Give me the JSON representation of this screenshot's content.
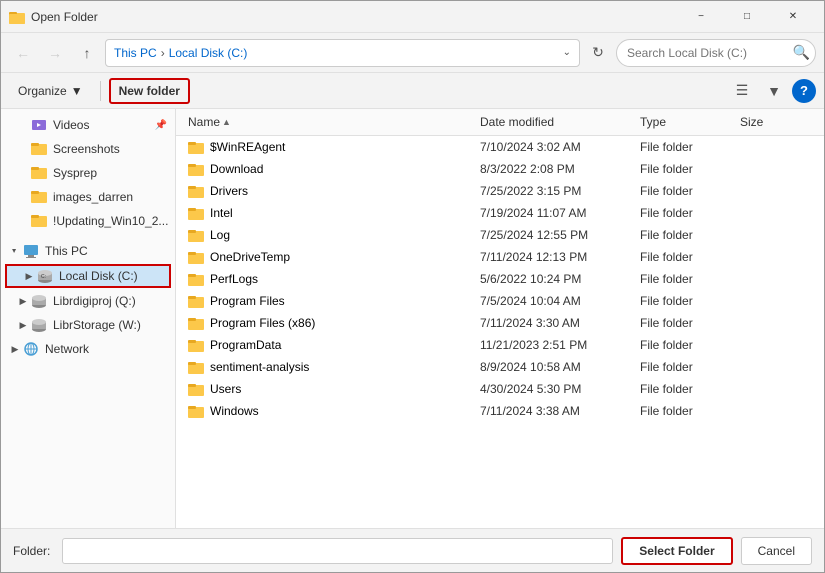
{
  "titleBar": {
    "title": "Open Folder",
    "iconUnicode": "📁"
  },
  "addressBar": {
    "backButton": "←",
    "forwardButton": "→",
    "upButton": "↑",
    "pathItems": [
      "This PC",
      "Local Disk (C:)"
    ],
    "refreshButton": "↻",
    "searchPlaceholder": "Search Local Disk (C:)",
    "searchIcon": "🔍"
  },
  "toolbar": {
    "organizeLabel": "Organize",
    "organizeDropdown": "▾",
    "newFolderLabel": "New folder",
    "viewIcon": "≡",
    "viewDropdown": "▾",
    "helpLabel": "?"
  },
  "sidebar": {
    "items": [
      {
        "id": "videos",
        "label": "Videos",
        "indent": 1,
        "icon": "video",
        "pinned": true
      },
      {
        "id": "screenshots",
        "label": "Screenshots",
        "indent": 1,
        "icon": "folder"
      },
      {
        "id": "sysprep",
        "label": "Sysprep",
        "indent": 1,
        "icon": "folder"
      },
      {
        "id": "images_darren",
        "label": "images_darren",
        "indent": 1,
        "icon": "folder"
      },
      {
        "id": "updating",
        "label": "!Updating_Win10_2...",
        "indent": 1,
        "icon": "folder"
      },
      {
        "id": "this-pc",
        "label": "This PC",
        "indent": 0,
        "icon": "pc",
        "expanded": true
      },
      {
        "id": "local-disk-c",
        "label": "Local Disk (C:)",
        "indent": 1,
        "icon": "drive",
        "selected": true,
        "hasChildren": true
      },
      {
        "id": "librdigiproj",
        "label": "Librdigiproj (Q:)",
        "indent": 1,
        "icon": "drive"
      },
      {
        "id": "librstorage",
        "label": "LibrStorage (W:)",
        "indent": 1,
        "icon": "drive"
      },
      {
        "id": "network",
        "label": "Network",
        "indent": 0,
        "icon": "network"
      }
    ]
  },
  "fileList": {
    "columns": [
      "Name",
      "Date modified",
      "Type",
      "Size"
    ],
    "sortColumn": "Name",
    "sortDirection": "asc",
    "rows": [
      {
        "name": "$WinREAgent",
        "dateModified": "7/10/2024 3:02 AM",
        "type": "File folder",
        "size": ""
      },
      {
        "name": "Download",
        "dateModified": "8/3/2022 2:08 PM",
        "type": "File folder",
        "size": ""
      },
      {
        "name": "Drivers",
        "dateModified": "7/25/2022 3:15 PM",
        "type": "File folder",
        "size": ""
      },
      {
        "name": "Intel",
        "dateModified": "7/19/2024 11:07 AM",
        "type": "File folder",
        "size": ""
      },
      {
        "name": "Log",
        "dateModified": "7/25/2024 12:55 PM",
        "type": "File folder",
        "size": ""
      },
      {
        "name": "OneDriveTemp",
        "dateModified": "7/11/2024 12:13 PM",
        "type": "File folder",
        "size": ""
      },
      {
        "name": "PerfLogs",
        "dateModified": "5/6/2022 10:24 PM",
        "type": "File folder",
        "size": ""
      },
      {
        "name": "Program Files",
        "dateModified": "7/5/2024 10:04 AM",
        "type": "File folder",
        "size": ""
      },
      {
        "name": "Program Files (x86)",
        "dateModified": "7/11/2024 3:30 AM",
        "type": "File folder",
        "size": ""
      },
      {
        "name": "ProgramData",
        "dateModified": "11/21/2023 2:51 PM",
        "type": "File folder",
        "size": ""
      },
      {
        "name": "sentiment-analysis",
        "dateModified": "8/9/2024 10:58 AM",
        "type": "File folder",
        "size": ""
      },
      {
        "name": "Users",
        "dateModified": "4/30/2024 5:30 PM",
        "type": "File folder",
        "size": ""
      },
      {
        "name": "Windows",
        "dateModified": "7/11/2024 3:38 AM",
        "type": "File folder",
        "size": ""
      }
    ]
  },
  "bottomBar": {
    "folderLabel": "Folder:",
    "folderValue": "",
    "selectButtonLabel": "Select Folder",
    "cancelButtonLabel": "Cancel"
  },
  "colors": {
    "accent": "#0066cc",
    "selected": "#cce4f7",
    "highlight": "#e8f4ff",
    "folderYellow": "#FCC84A",
    "borderRed": "#cc0000"
  }
}
